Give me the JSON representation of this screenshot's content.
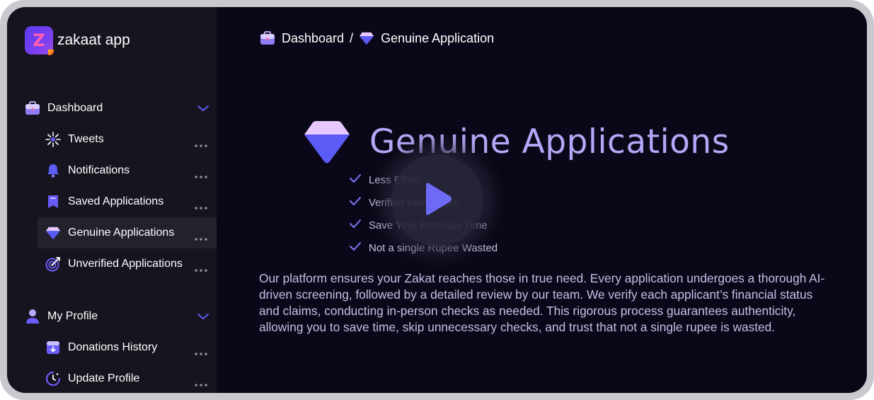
{
  "app": {
    "name": "zakaat app",
    "logo_letter": "Z"
  },
  "sidebar": {
    "groups": [
      {
        "label": "Dashboard",
        "icon": "briefcase-icon",
        "expanded": true,
        "items": [
          {
            "label": "Tweets",
            "icon": "sparkle-icon",
            "active": false
          },
          {
            "label": "Notifications",
            "icon": "bell-icon",
            "active": false
          },
          {
            "label": "Saved Applications",
            "icon": "bookmark-icon",
            "active": false
          },
          {
            "label": "Genuine Applications",
            "icon": "diamond-icon",
            "active": true
          },
          {
            "label": "Unverified Applications",
            "icon": "target-icon",
            "active": false
          }
        ]
      },
      {
        "label": "My Profile",
        "icon": "user-icon",
        "expanded": true,
        "items": [
          {
            "label": "Donations History",
            "icon": "archive-icon",
            "active": false
          },
          {
            "label": "Update Profile",
            "icon": "clock-icon",
            "active": false
          }
        ]
      }
    ]
  },
  "breadcrumb": {
    "root": "Dashboard",
    "separator": "/",
    "current": "Genuine Application"
  },
  "hero": {
    "title": "Genuine Applications",
    "checklist": [
      "Less Effort",
      "Verified Individuals",
      "Save Your Precious Time",
      "Not a single Rupee Wasted"
    ],
    "description": "Our platform ensures your Zakat reaches those in true need. Every application undergoes a thorough AI-driven screening, followed by a detailed review by our team. We verify each applicant’s financial status and claims, conducting in-person checks as needed. This rigorous process guarantees authenticity, allowing you to save time, skip unnecessary checks, and trust that not a single rupee is wasted."
  },
  "colors": {
    "background": "#0a0818",
    "sidebar": "#16151f",
    "accent": "#5b5bf6",
    "title": "#b4a7f7"
  }
}
